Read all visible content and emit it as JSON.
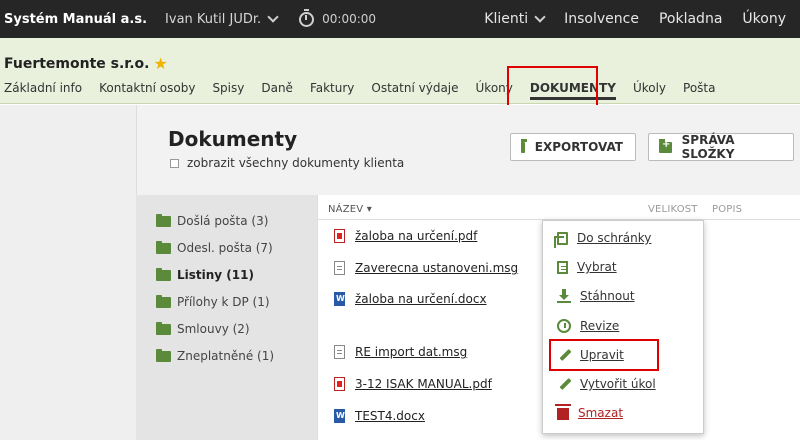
{
  "topbar": {
    "brand": "Systém Manuál a.s.",
    "user": "Ivan Kutil JUDr.",
    "timer": "00:00:00",
    "nav": [
      "Klienti",
      "Insolvence",
      "Pokladna",
      "Úkony"
    ]
  },
  "client": {
    "name": "Fuertemonte s.r.o.",
    "tabs": [
      "Základní info",
      "Kontaktní osoby",
      "Spisy",
      "Daně",
      "Faktury",
      "Ostatní výdaje",
      "Úkony",
      "DOKUMENTY",
      "Úkoly",
      "Pošta"
    ],
    "active_tab": "DOKUMENTY"
  },
  "panel": {
    "title": "Dokumenty",
    "show_all": "zobrazit všechny dokumenty klienta",
    "export_label": "EXPORTOVAT",
    "manage_label": "SPRÁVA SLOŽKY"
  },
  "folders": [
    {
      "label": "Došlá pošta (3)"
    },
    {
      "label": "Odesl. pošta (7)"
    },
    {
      "label": "Listiny (11)",
      "active": true
    },
    {
      "label": "Přílohy k DP (1)"
    },
    {
      "label": "Smlouvy (2)"
    },
    {
      "label": "Zneplatněné (1)"
    }
  ],
  "files": {
    "columns": {
      "name": "NÁZEV",
      "size": "VELIKOST",
      "desc": "POPIS"
    },
    "rows": [
      {
        "name": "žaloba na určení.pdf",
        "type": "pdf"
      },
      {
        "name": "Zaverecna ustanoveni.msg",
        "type": "txt"
      },
      {
        "name": "žaloba na určení.docx",
        "type": "doc"
      },
      {
        "name": "RE import dat.msg",
        "type": "txt"
      },
      {
        "name": "3-12 ISAK MANUAL.pdf",
        "type": "pdf"
      },
      {
        "name": "TEST4.docx",
        "type": "doc"
      }
    ]
  },
  "context_menu": [
    {
      "label": "Do schránky",
      "icon": "copy-icon"
    },
    {
      "label": "Vybrat",
      "icon": "select-icon"
    },
    {
      "label": "Stáhnout",
      "icon": "download-icon"
    },
    {
      "label": "Revize",
      "icon": "history-icon"
    },
    {
      "label": "Upravit",
      "icon": "pencil-icon"
    },
    {
      "label": "Vytvořit úkol",
      "icon": "pencil-icon"
    },
    {
      "label": "Smazat",
      "icon": "trash-icon"
    }
  ],
  "colors": {
    "accent": "#5a8a3a",
    "highlight": "#e10000",
    "danger": "#b22222",
    "topbar": "#262626",
    "client_bg": "#e9f0dc"
  }
}
